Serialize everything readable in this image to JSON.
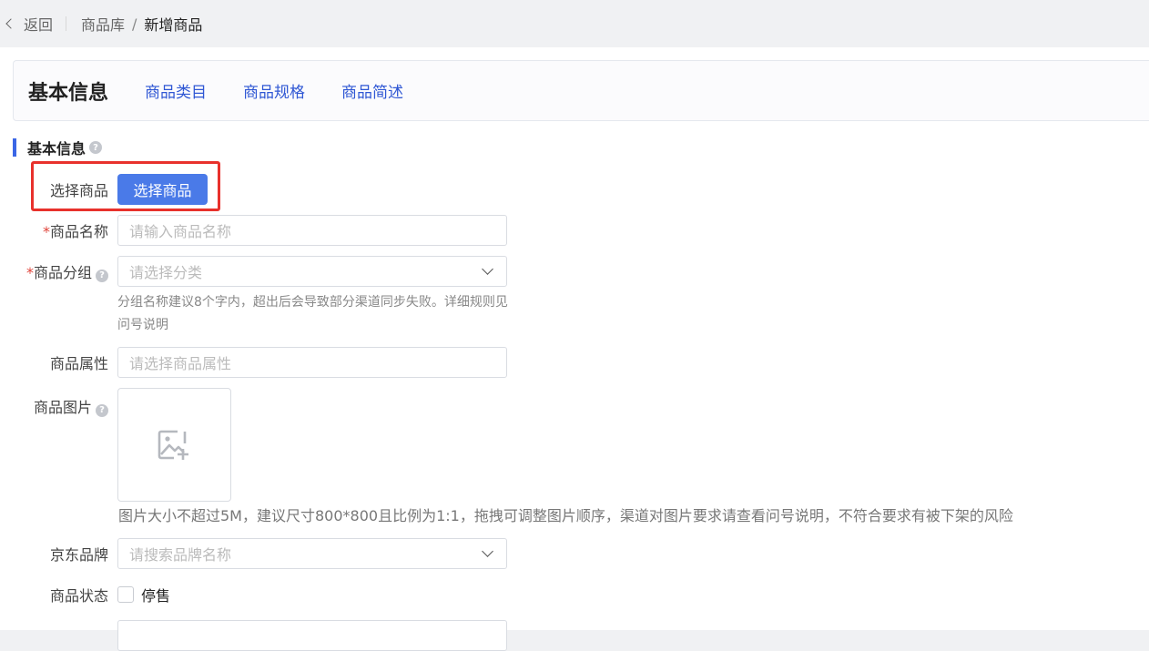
{
  "breadcrumb": {
    "back_label": "返回",
    "library": "商品库",
    "current": "新增商品"
  },
  "tabs": {
    "active": "基本信息",
    "links": [
      "商品类目",
      "商品规格",
      "商品简述"
    ]
  },
  "section": {
    "title": "基本信息"
  },
  "form": {
    "select_product": {
      "label": "选择商品",
      "button": "选择商品"
    },
    "name": {
      "label": "商品名称",
      "required_mark": "*",
      "placeholder": "请输入商品名称"
    },
    "group": {
      "label": "商品分组",
      "required_mark": "*",
      "placeholder": "请选择分类",
      "hint": "分组名称建议8个字内，超出后会导致部分渠道同步失败。详细规则见问号说明"
    },
    "attributes": {
      "label": "商品属性",
      "placeholder": "请选择商品属性"
    },
    "images": {
      "label": "商品图片",
      "hint": "图片大小不超过5M，建议尺寸800*800且比例为1:1，拖拽可调整图片顺序，渠道对图片要求请查看问号说明，不符合要求有被下架的风险"
    },
    "brand": {
      "label": "京东品牌",
      "placeholder": "请搜索品牌名称"
    },
    "status": {
      "label": "商品状态",
      "option": "停售"
    }
  },
  "icons": {
    "help": "?",
    "back": "chevron-left-icon",
    "upload": "image-add-icon",
    "dropdown": "chevron-down-icon"
  },
  "colors": {
    "primary_button": "#4a7ae8",
    "tab_link": "#2f57d4",
    "section_bar": "#3b66e6",
    "required": "#e0443a",
    "highlight_box": "#e8312c"
  }
}
